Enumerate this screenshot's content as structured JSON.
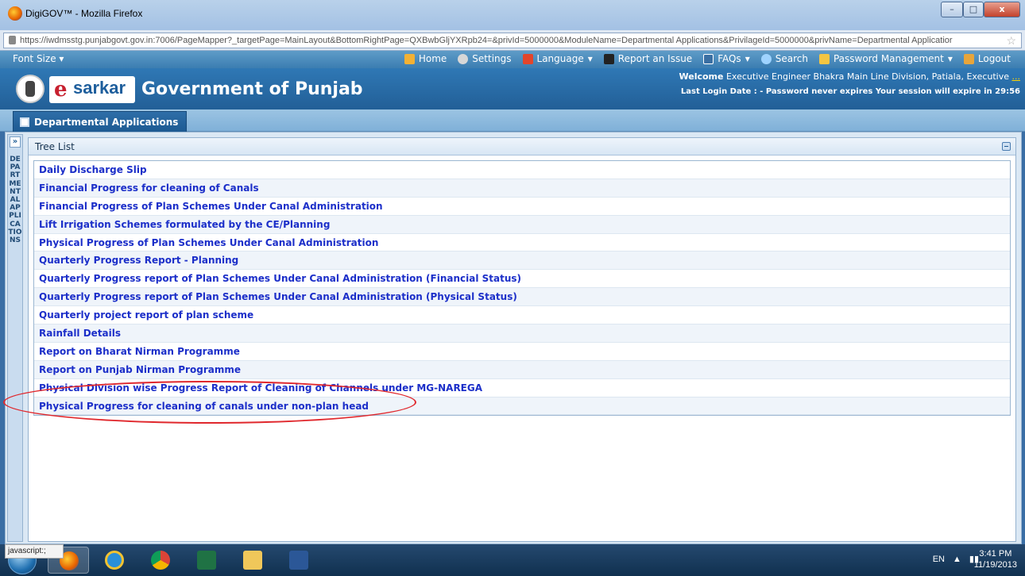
{
  "window": {
    "title": "DigiGOV™ - Mozilla Firefox",
    "minimize": "–",
    "maximize": "□",
    "close": "x"
  },
  "url": {
    "value": "https://iwdmsstg.punjabgovt.gov.in:7006/PageMapper?_targetPage=MainLayout&BottomRightPage=QXBwbGljYXRpb24=&privId=5000000&ModuleName=Departmental Applications&PrivilageId=5000000&privName=Departmental Applicatior"
  },
  "navbar": {
    "font_size": "Font Size",
    "items": [
      {
        "label": "Home",
        "icon": "home-icon"
      },
      {
        "label": "Settings",
        "icon": "gear-icon"
      },
      {
        "label": "Language",
        "icon": "language-icon"
      },
      {
        "label": "Report an Issue",
        "icon": "phone-icon"
      },
      {
        "label": "FAQs",
        "icon": "faq-icon"
      },
      {
        "label": "Search",
        "icon": "search-icon"
      },
      {
        "label": "Password Management",
        "icon": "key-icon"
      },
      {
        "label": "Logout",
        "icon": "logout-icon"
      }
    ]
  },
  "header": {
    "brand_e": "e",
    "brand_sarkar": "sarkar",
    "title": "Government of Punjab",
    "welcome_label": "Welcome",
    "welcome_text": "Executive Engineer Bhakra Main Line Division, Patiala, Executive",
    "welcome_more": "...",
    "login_line": "Last Login Date : - Password never expires  Your session will expire in 29:56"
  },
  "tab": {
    "label": "Departmental Applications"
  },
  "sidebar": {
    "expand": "»",
    "vertical_label": "DEPARTMENTAL APPLICATIONS"
  },
  "panel": {
    "title": "Tree List",
    "items": [
      "Daily Discharge Slip",
      "Financial Progress for cleaning of Canals",
      "Financial Progress of Plan Schemes Under Canal Administration",
      "Lift Irrigation Schemes formulated by the CE/Planning",
      "Physical Progress of Plan Schemes Under Canal Administration",
      "Quarterly Progress Report - Planning",
      "Quarterly Progress report of Plan Schemes Under Canal Administration (Financial Status)",
      "Quarterly Progress report of Plan Schemes Under Canal Administration (Physical Status)",
      "Quarterly project report of plan scheme",
      "Rainfall Details",
      "Report on Bharat Nirman Programme",
      "Report on Punjab Nirman Programme",
      "Physical Division wise Progress Report of Cleaning of Channels under MG-NAREGA",
      "Physical Progress for cleaning of canals under non-plan head"
    ]
  },
  "status_bar": "javascript:;",
  "taskbar": {
    "apps": [
      "firefox-icon",
      "internet-explorer-icon",
      "chrome-icon",
      "excel-icon",
      "file-explorer-icon",
      "word-icon"
    ],
    "lang": "EN",
    "time": "3:41 PM",
    "date": "11/19/2013"
  },
  "colors": {
    "link": "#1c2fc9",
    "header_blue": "#225f97",
    "annotation": "#e0282d"
  }
}
